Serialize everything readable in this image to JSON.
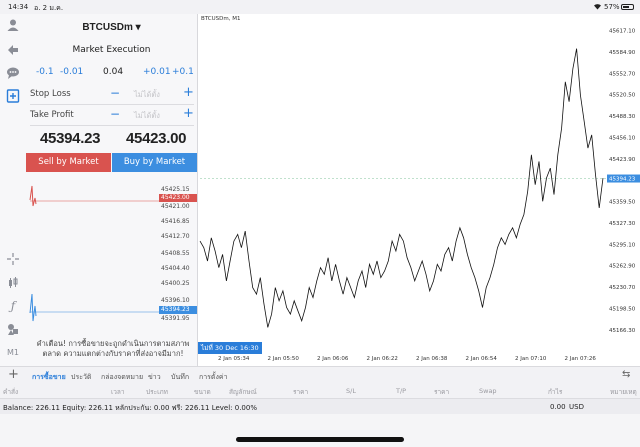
{
  "status": {
    "time": "14:34",
    "date": "อ. 2 ม.ค.",
    "battery": "57%"
  },
  "toolbar": {
    "chart_type_label": "M1"
  },
  "order_panel": {
    "symbol": "BTCUSDm ▾",
    "execution": "Market Execution",
    "volume_steps": [
      "-0.1",
      "-0.01",
      "+0.01",
      "+0.1"
    ],
    "volume": "0.04",
    "stop_loss_label": "Stop Loss",
    "take_profit_label": "Take Profit",
    "not_set_placeholder": "ไม่ได้ตั้ง",
    "minus": "−",
    "plus": "+",
    "bid_main": "45394.",
    "bid_small": "23",
    "ask_main": "45423.",
    "ask_small": "00",
    "sell_label": "Sell by Market",
    "buy_label": "Buy by Market",
    "tick_prices": [
      "45425.15",
      "45423.00",
      "45421.00",
      "45416.85",
      "45412.70",
      "45408.55",
      "45404.40",
      "45400.25",
      "45396.10",
      "45394.23",
      "45391.95"
    ],
    "warning": "คำเตือน! การซื้อขายจะถูกดำเนินการตามสภาพตลาด ความแตกต่างกับราคาที่ส่งอาจมีมาก!"
  },
  "chart": {
    "title": "BTCUSDm, M1",
    "date_badge": "ไม่ที่ 30 Dec 16:30",
    "bid_line_label": "45394.23"
  },
  "chart_data": {
    "type": "line",
    "title": "BTCUSDm, M1",
    "xlabel": "",
    "ylabel": "",
    "ylim": [
      45148.0,
      45630.0
    ],
    "y_ticks": [
      "45617.10",
      "45584.90",
      "45552.70",
      "45520.50",
      "45488.30",
      "45456.10",
      "45423.90",
      "45394.23",
      "45359.50",
      "45327.30",
      "45295.10",
      "45262.90",
      "45230.70",
      "45198.50",
      "45166.30"
    ],
    "x_ticks": [
      "2 Jan 05:34",
      "2 Jan 05:50",
      "2 Jan 06:06",
      "2 Jan 06:22",
      "2 Jan 06:38",
      "2 Jan 06:54",
      "2 Jan 07:10",
      "2 Jan 07:26"
    ],
    "grid": false,
    "series": [
      {
        "values": [
          45300,
          45290,
          45270,
          45305,
          45285,
          45260,
          45280,
          45240,
          45270,
          45300,
          45310,
          45290,
          45315,
          45270,
          45230,
          45220,
          45245,
          45205,
          45170,
          45190,
          45230,
          45210,
          45225,
          45200,
          45190,
          45210,
          45195,
          45180,
          45200,
          45230,
          45215,
          45240,
          45260,
          45250,
          45275,
          45240,
          45265,
          45240,
          45220,
          45245,
          45230,
          45215,
          45240,
          45255,
          45230,
          45265,
          45250,
          45270,
          45245,
          45255,
          45270,
          45300,
          45285,
          45310,
          45300,
          45275,
          45260,
          45240,
          45255,
          45270,
          45250,
          45225,
          45240,
          45265,
          45255,
          45280,
          45290,
          45270,
          45300,
          45320,
          45305,
          45280,
          45260,
          45245,
          45225,
          45200,
          45230,
          45245,
          45265,
          45290,
          45305,
          45295,
          45310,
          45320,
          45305,
          45325,
          45340,
          45375,
          45430,
          45385,
          45420,
          45360,
          45395,
          45410,
          45370,
          45430,
          45470,
          45540,
          45510,
          45560,
          45590,
          45520,
          45480,
          45440,
          45460,
          45400,
          45350,
          45395
        ]
      }
    ]
  },
  "tabs": [
    "การซื้อขาย",
    "ประวัติ",
    "กล่องจดหมาย",
    "ข่าว",
    "บันทึก",
    "การตั้งค่า"
  ],
  "table_headers": [
    "คำสั่ง",
    "เวลา",
    "ประเภท",
    "ขนาด",
    "สัญลักษณ์",
    "ราคา",
    "S/L",
    "T/P",
    "ราคา",
    "Swap",
    "กำไร",
    "หมายเหตุ"
  ],
  "balance": {
    "text": "Balance: 226.11 Equity: 226.11 หลักประกัน: 0.00 ฟรี: 226.11 Level: 0.00%",
    "amount": "0.00",
    "currency": "USD"
  },
  "colors": {
    "sell": "#d9534f",
    "buy": "#3c8ee0",
    "accent": "#2a7dd9"
  }
}
